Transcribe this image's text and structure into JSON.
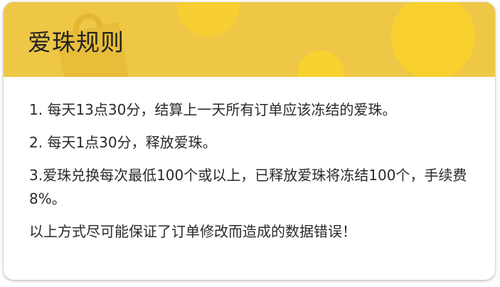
{
  "panel": {
    "title": "爱珠规则",
    "header_color": "#efc747",
    "header_decoration_icon": "shopping-bag-icon"
  },
  "rules": [
    "1. 每天13点30分，结算上一天所有订单应该冻结的爱珠。",
    "2. 每天1点30分，释放爱珠。",
    "3.爱珠兑换每次最低100个或以上，已释放爱珠将冻结100个，手续费8%。",
    "以上方式尽可能保证了订单修改而造成的数据错误！"
  ]
}
